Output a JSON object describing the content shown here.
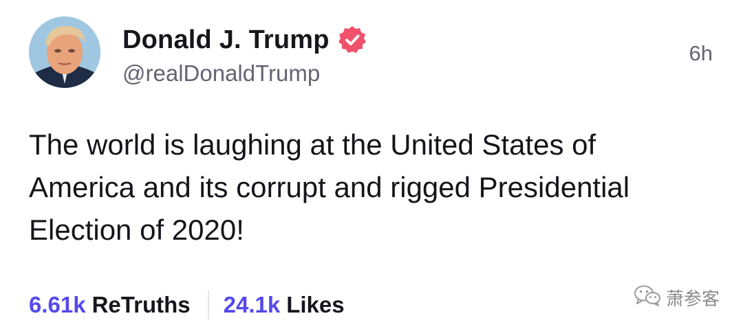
{
  "post": {
    "author": {
      "display_name": "Donald J. Trump",
      "handle": "@realDonaldTrump",
      "verified": true,
      "avatar": "profile-photo"
    },
    "timestamp": "6h",
    "text": "The world is laughing at the United States of\nAmerica and its corrupt and rigged Presidential\nElection of 2020!",
    "stats": {
      "retruths_count": "6.61k",
      "retruths_label": "ReTruths",
      "likes_count": "24.1k",
      "likes_label": "Likes"
    }
  },
  "watermark": {
    "icon": "wechat-icon",
    "text": "萧参客"
  },
  "colors": {
    "accent": "#5448ee",
    "verified_badge": "#f0516b",
    "secondary_text": "#656372",
    "primary_text": "#16141a"
  }
}
